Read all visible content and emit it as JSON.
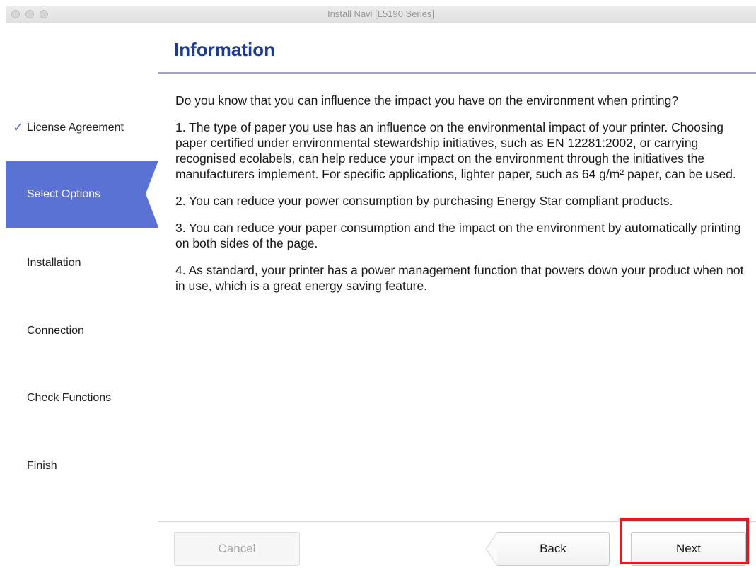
{
  "window": {
    "title": "Install Navi [L5190 Series]"
  },
  "sidebar": {
    "items": [
      {
        "label": "License Agreement",
        "state": "completed",
        "icon": "checkmark-icon"
      },
      {
        "label": "Select Options",
        "state": "active"
      },
      {
        "label": "Installation",
        "state": "pending"
      },
      {
        "label": "Connection",
        "state": "pending"
      },
      {
        "label": "Check Functions",
        "state": "pending"
      },
      {
        "label": "Finish",
        "state": "pending"
      }
    ],
    "active_color": "#5a72d4"
  },
  "main": {
    "heading": "Information",
    "paragraphs": [
      "Do you know that you can influence the impact you have on the environment when printing?",
      "1. The type of paper you use has an influence on the environmental impact of your printer. Choosing paper certified under environmental stewardship initiatives, such as EN 12281:2002, or carrying recognised ecolabels, can help reduce your impact on the environment through the initiatives the manufacturers implement. For specific applications, lighter paper, such as 64 g/m² paper, can be used.",
      "2. You can reduce your power consumption by purchasing Energy Star compliant products.",
      "3. You can reduce your paper consumption and the impact on the environment by automatically printing on both sides of the page.",
      "4. As standard, your printer has a power management function that powers down your product when not in use, which is a great energy saving feature."
    ]
  },
  "footer": {
    "cancel_label": "Cancel",
    "cancel_enabled": false,
    "back_label": "Back",
    "next_label": "Next",
    "highlight_color": "#e01b1b"
  }
}
